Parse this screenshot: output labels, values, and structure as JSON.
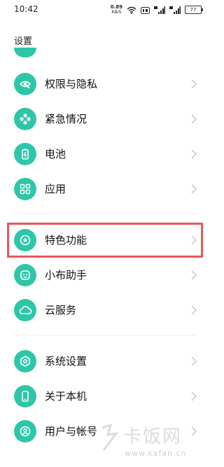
{
  "status_bar": {
    "time": "10:42",
    "net_speed_value": "0.89",
    "net_speed_unit": "KB/S",
    "battery_level": "77",
    "icons": [
      "wifi-icon",
      "hd-icon",
      "signal-5g-icon",
      "signal-4g-icon",
      "battery-icon"
    ]
  },
  "header": {
    "title": "设置"
  },
  "colors": {
    "icon_bg": "#2ec6a8",
    "highlight": "#e8575c"
  },
  "groups": [
    {
      "items": [
        {
          "label": "权限与隐私",
          "icon": "privacy-eye-icon"
        },
        {
          "label": "紧急情况",
          "icon": "emergency-icon"
        },
        {
          "label": "电池",
          "icon": "battery-icon"
        },
        {
          "label": "应用",
          "icon": "apps-grid-icon"
        }
      ]
    },
    {
      "items": [
        {
          "label": "特色功能",
          "icon": "special-feature-icon",
          "highlighted": true
        },
        {
          "label": "小布助手",
          "icon": "assistant-icon"
        },
        {
          "label": "云服务",
          "icon": "cloud-icon"
        }
      ]
    },
    {
      "items": [
        {
          "label": "系统设置",
          "icon": "system-settings-icon"
        },
        {
          "label": "关于本机",
          "icon": "phone-icon"
        },
        {
          "label": "用户与帐号",
          "icon": "user-icon"
        }
      ]
    }
  ],
  "watermark": {
    "name": "卡饭网",
    "url": "www.kafan.cn"
  }
}
